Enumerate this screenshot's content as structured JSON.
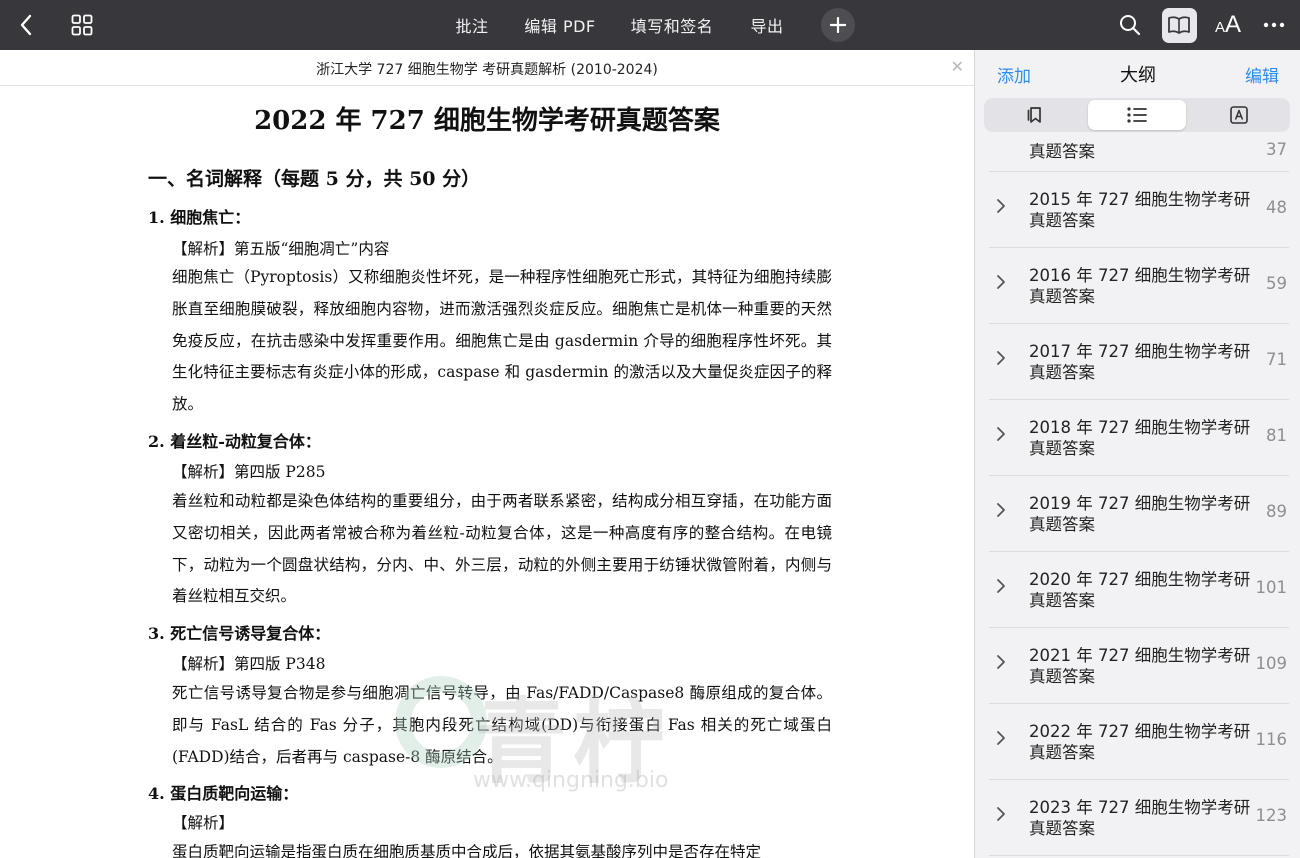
{
  "toolbar": {
    "annotate": "批注",
    "edit_pdf": "编辑 PDF",
    "fill_sign": "填写和签名",
    "export": "导出"
  },
  "document": {
    "file_title": "浙江大学 727 细胞生物学 考研真题解析 (2010-2024)",
    "page_title": "2022 年 727 细胞生物学考研真题答案",
    "section_title": "一、名词解释（每题 5 分，共 50 分）",
    "items": [
      {
        "title": "1.  细胞焦亡：",
        "tag": "【解析】第五版“细胞凋亡”内容",
        "text": "细胞焦亡（Pyroptosis）又称细胞炎性坏死，是一种程序性细胞死亡形式，其特征为细胞持续膨胀直至细胞膜破裂，释放细胞内容物，进而激活强烈炎症反应。细胞焦亡是机体一种重要的天然免疫反应，在抗击感染中发挥重要作用。细胞焦亡是由 gasdermin 介导的细胞程序性坏死。其生化特征主要标志有炎症小体的形成，caspase 和 gasdermin 的激活以及大量促炎症因子的释放。"
      },
      {
        "title": "2.  着丝粒-动粒复合体：",
        "tag": "【解析】第四版 P285",
        "text": "着丝粒和动粒都是染色体结构的重要组分，由于两者联系紧密，结构成分相互穿插，在功能方面又密切相关，因此两者常被合称为着丝粒-动粒复合体，这是一种高度有序的整合结构。在电镜下，动粒为一个圆盘状结构，分内、中、外三层，动粒的外侧主要用于纺锤状微管附着，内侧与着丝粒相互交织。"
      },
      {
        "title": "3.  死亡信号诱导复合体：",
        "tag": "【解析】第四版 P348",
        "text": "死亡信号诱导复合物是参与细胞凋亡信号转导，由 Fas/FADD/Caspase8 酶原组成的复合体。即与 FasL 结合的 Fas 分子，其胞内段死亡结构域(DD)与衔接蛋白 Fas 相关的死亡域蛋白(FADD)结合，后者再与 caspase-8 酶原结合。"
      },
      {
        "title": "4.  蛋白质靶向运输：",
        "tag": "【解析】",
        "text": "蛋白质靶向运输是指蛋白质在细胞质基质中合成后，依据其氨基酸序列中是否存在特定"
      }
    ],
    "watermark": {
      "text": "青柠",
      "url": "www.qingning.bio"
    }
  },
  "sidebar": {
    "add": "添加",
    "title": "大纲",
    "edit": "编辑",
    "outline": [
      {
        "label": "真题答案",
        "page": "37"
      },
      {
        "label": "2015 年 727 细胞生物学考研真题答案",
        "page": "48"
      },
      {
        "label": "2016 年 727 细胞生物学考研真题答案",
        "page": "59"
      },
      {
        "label": "2017 年 727 细胞生物学考研真题答案",
        "page": "71"
      },
      {
        "label": "2018 年 727 细胞生物学考研真题答案",
        "page": "81"
      },
      {
        "label": "2019 年 727 细胞生物学考研真题答案",
        "page": "89"
      },
      {
        "label": "2020 年 727 细胞生物学考研真题答案",
        "page": "101"
      },
      {
        "label": "2021 年 727 细胞生物学考研真题答案",
        "page": "109"
      },
      {
        "label": "2022 年 727 细胞生物学考研真题答案",
        "page": "116"
      },
      {
        "label": "2023 年 727 细胞生物学考研真题答案",
        "page": "123"
      }
    ]
  }
}
